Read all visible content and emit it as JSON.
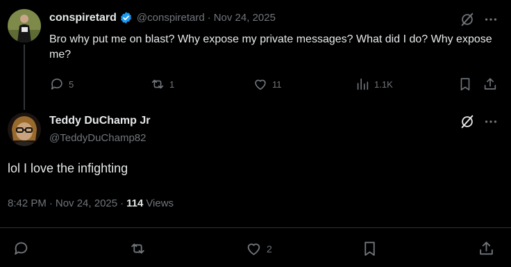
{
  "parent_post": {
    "display_name": "conspiretard",
    "handle": "@conspiretard",
    "separator": "·",
    "date": "Nov 24, 2025",
    "text": "Bro why put me on blast? Why expose my private messages? What did I do? Why expose me?",
    "replies": "5",
    "reposts": "1",
    "likes": "11",
    "views": "1.1K",
    "verified_color": "#1d9bf0"
  },
  "main_post": {
    "display_name": "Teddy DuChamp Jr",
    "handle": "@TeddyDuChamp82",
    "text": "lol I love the infighting",
    "time": "8:42 PM",
    "separator": "·",
    "date": "Nov 24, 2025",
    "separator2": "·",
    "views_count": "114",
    "views_label": "Views",
    "likes": "2"
  },
  "colors": {
    "background": "#000000",
    "text": "#e7e9ea",
    "muted": "#71767b",
    "divider": "#2f3336"
  },
  "icons": [
    "grok-icon",
    "more-icon",
    "verified-badge-icon",
    "reply-icon",
    "repost-icon",
    "like-icon",
    "views-icon",
    "bookmark-icon",
    "share-icon"
  ]
}
